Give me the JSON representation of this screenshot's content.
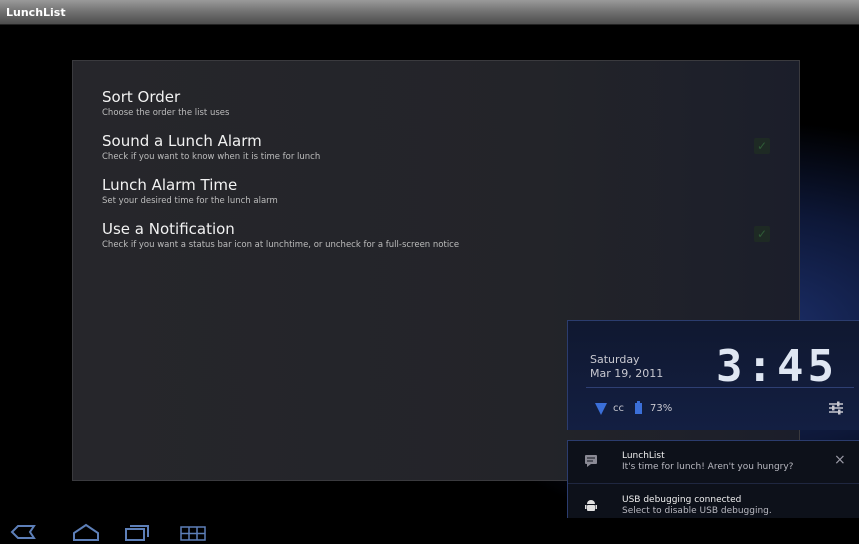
{
  "window": {
    "title": "LunchList"
  },
  "preferences": [
    {
      "title": "Sort Order",
      "summary": "Choose the order the list uses",
      "has_checkbox": false
    },
    {
      "title": "Sound a Lunch Alarm",
      "summary": "Check if you want to know when it is time for lunch",
      "has_checkbox": true,
      "checked": true
    },
    {
      "title": "Lunch Alarm Time",
      "summary": "Set your desired time for the lunch alarm",
      "has_checkbox": false
    },
    {
      "title": "Use a Notification",
      "summary": "Check if you want a status bar icon at lunchtime, or uncheck for a full-screen notice",
      "has_checkbox": true,
      "checked": true
    }
  ],
  "status": {
    "day": "Saturday",
    "date": "Mar 19, 2011",
    "time": "3:45",
    "carrier": "cc",
    "battery": "73%",
    "icons": [
      "wifi-icon",
      "battery-icon",
      "settings-icon"
    ]
  },
  "notifications": [
    {
      "title": "LunchList",
      "text": "It's time for lunch! Aren't you hungry?",
      "icon": "message-icon",
      "closable": true
    },
    {
      "title": "USB debugging connected",
      "text": "Select to disable USB debugging.",
      "icon": "android-icon",
      "closable": false
    }
  ],
  "navbar": {
    "icons": [
      "back-icon",
      "home-icon",
      "recent-apps-icon",
      "menu-icon"
    ]
  },
  "colors": {
    "accent": "#2b3c6e",
    "panel": "#232429",
    "check": "#2f5b37"
  }
}
